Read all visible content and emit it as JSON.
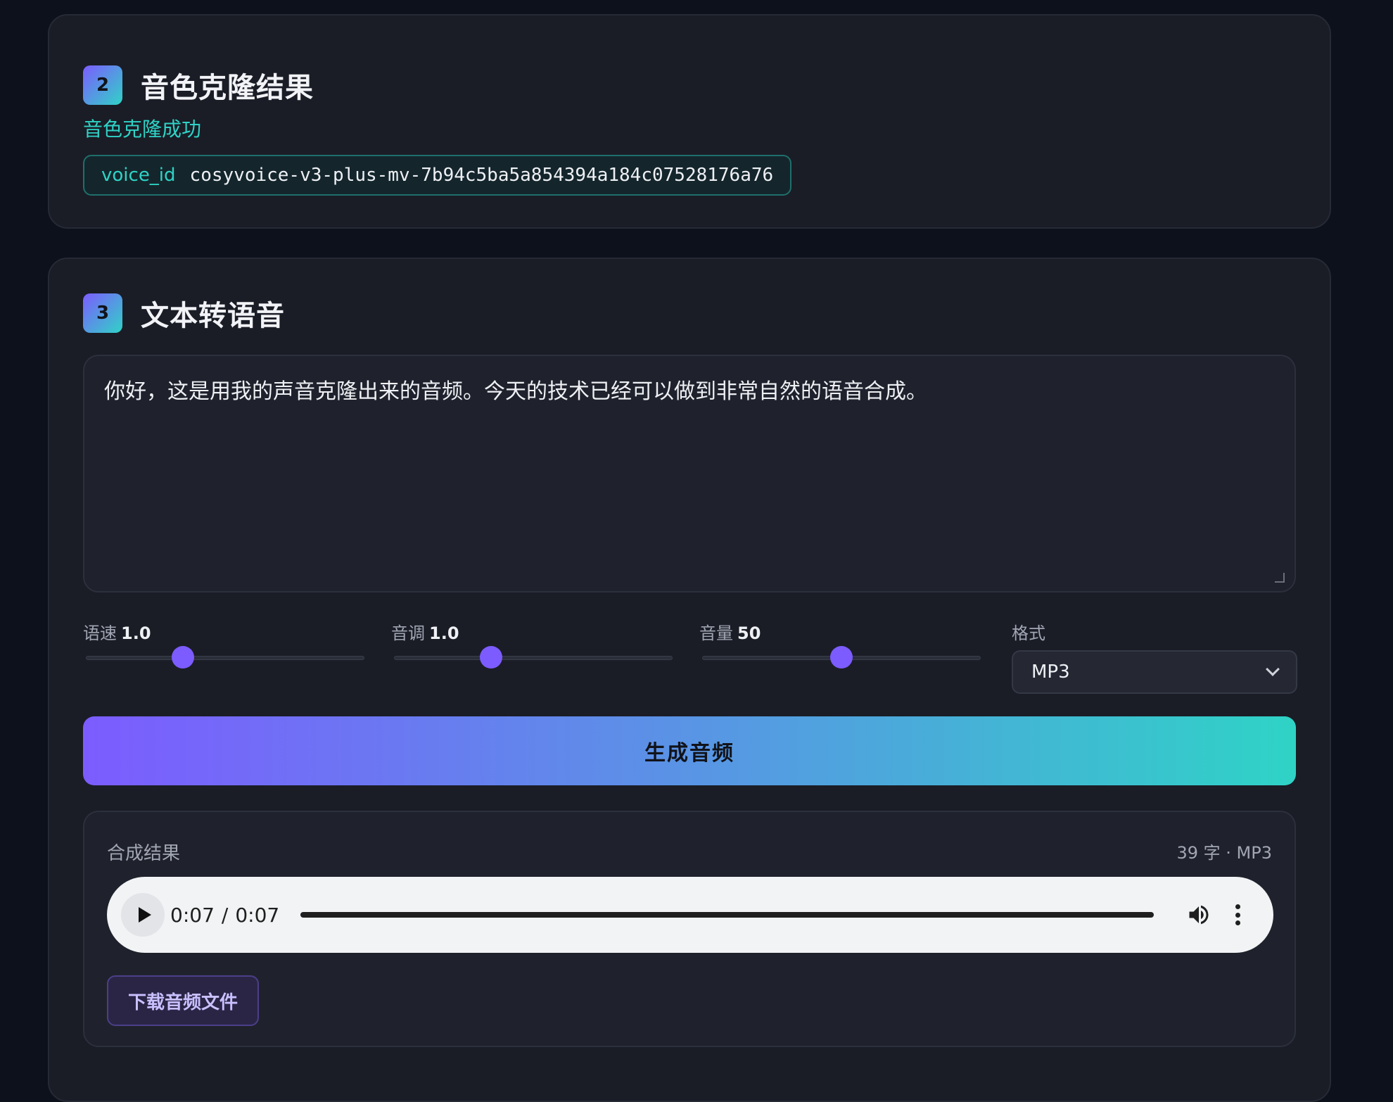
{
  "clone_result": {
    "step": "2",
    "title": "音色克隆结果",
    "status": "音色克隆成功",
    "voice_id_label": "voice_id",
    "voice_id_value": "cosyvoice-v3-plus-mv-7b94c5ba5a854394a184c07528176a76"
  },
  "tts": {
    "step": "3",
    "title": "文本转语音",
    "text": "你好，这是用我的声音克隆出来的音频。今天的技术已经可以做到非常自然的语音合成。",
    "controls": {
      "speed": {
        "label": "语速",
        "value": "1.0"
      },
      "pitch": {
        "label": "音调",
        "value": "1.0"
      },
      "volume": {
        "label": "音量",
        "value": "50"
      },
      "format": {
        "label": "格式",
        "selected": "MP3"
      }
    },
    "generate_label": "生成音频",
    "result": {
      "title": "合成结果",
      "meta": "39 字 · MP3",
      "current_time": "0:07",
      "time_separator": "/",
      "duration": "0:07",
      "progress": 1.0,
      "download_label": "下载音频文件"
    }
  },
  "colors": {
    "accent_purple": "#7c5cff",
    "accent_teal": "#2fd3c6",
    "background": "#0d111b",
    "card": "#1a1d26"
  },
  "icons": [
    "play-icon",
    "volume-icon",
    "more-vert-icon",
    "chevron-down-icon"
  ]
}
